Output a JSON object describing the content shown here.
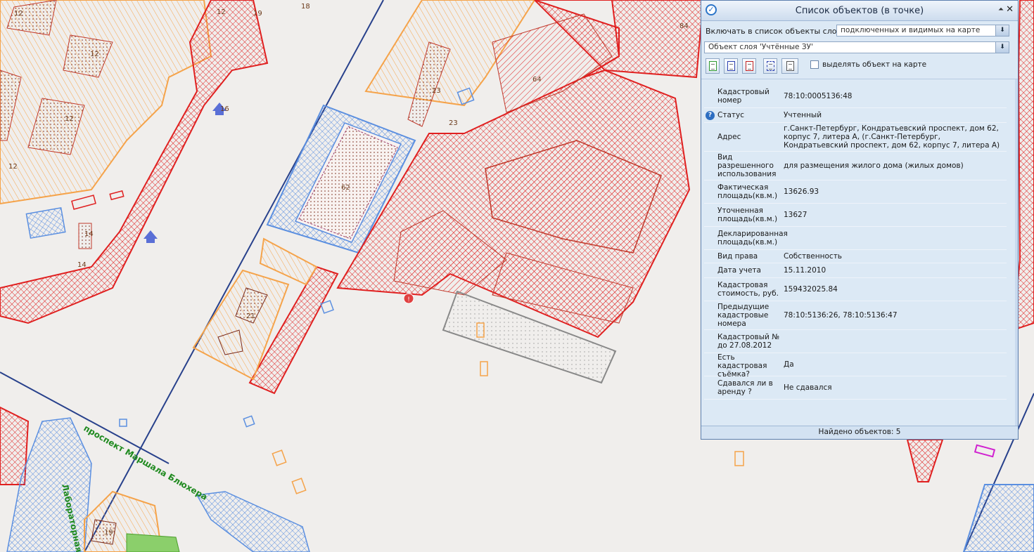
{
  "colors": {
    "parcel_red": "#e02020",
    "parcel_orange": "#f5a34a",
    "parcel_blue": "#5b8fe0",
    "road_blue": "#27408b",
    "street_green": "#1f8a1f",
    "panel_bg": "#dce9f5"
  },
  "map": {
    "labels": [
      "12",
      "12",
      "12",
      "12",
      "12",
      "19",
      "18",
      "14",
      "14",
      "62",
      "64",
      "84",
      "23",
      "23",
      "21",
      "19",
      "16"
    ],
    "streets": [
      "проспект Маршала Блюхера",
      "Лабораторная"
    ]
  },
  "panel": {
    "title": "Список объектов (в точке)",
    "title_icon": "checkmark-circle-icon",
    "collapse_glyph": "⏶",
    "close_glyph": "✕",
    "layers_label": "Включать в список объекты слоев:",
    "layers_value": "подключенных и видимых на карте",
    "object_layer_value": "Объект слоя 'Учтённые ЗУ'",
    "highlight_label": "выделять объект на карте",
    "tools": [
      "export-green-icon",
      "export-blue-icon",
      "export-red-icon",
      "select-area-icon",
      "document-icon"
    ],
    "properties": [
      {
        "key": "Кадастровый номер",
        "value": "78:10:0005136:48"
      },
      {
        "key": "Статус",
        "value": "Учтенный",
        "info": true
      },
      {
        "key": "Адрес",
        "value": "г.Санкт-Петербург, Кондратьевский проспект, дом 62, корпус 7, литера А, (г.Санкт-Петербург, Кондратьевский проспект, дом 62, корпус 7, литера А)"
      },
      {
        "key": "Вид разрешенного использования",
        "value": "для размещения жилого дома (жилых домов)"
      },
      {
        "key": "Фактическая площадь(кв.м.)",
        "value": "13626.93"
      },
      {
        "key": "Уточненная площадь(кв.м.)",
        "value": "13627"
      },
      {
        "key": "Декларированная площадь(кв.м.)",
        "value": ""
      },
      {
        "key": "Вид права",
        "value": "Собственность"
      },
      {
        "key": "Дата учета",
        "value": "15.11.2010"
      },
      {
        "key": "Кадастровая стоимость, руб.",
        "value": "159432025.84"
      },
      {
        "key": "Предыдущие кадастровые номера",
        "value": "78:10:5136:26, 78:10:5136:47"
      },
      {
        "key": "Кадастровый № до 27.08.2012",
        "value": ""
      },
      {
        "key": "Есть кадастровая съёмка?",
        "value": "Да"
      },
      {
        "key": "Сдавался ли в аренду ?",
        "value": "Не сдавался"
      }
    ],
    "status": "Найдено объектов: 5"
  }
}
